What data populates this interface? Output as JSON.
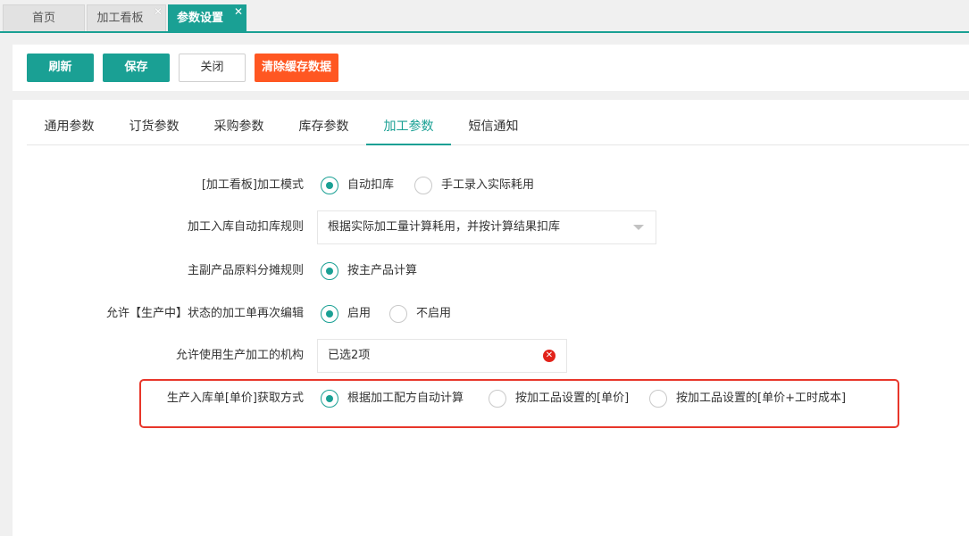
{
  "top_tabs": [
    {
      "label": "首页",
      "closable": false,
      "active": false
    },
    {
      "label": "加工看板",
      "closable": true,
      "active": false
    },
    {
      "label": "参数设置",
      "closable": true,
      "active": true
    }
  ],
  "toolbar": {
    "refresh_label": "刷新",
    "save_label": "保存",
    "close_label": "关闭",
    "clear_cache_label": "清除缓存数据"
  },
  "sub_tabs": [
    "通用参数",
    "订货参数",
    "采购参数",
    "库存参数",
    "加工参数",
    "短信通知"
  ],
  "active_sub_tab": "加工参数",
  "form": {
    "processing_mode": {
      "label": "[加工看板]加工模式",
      "options": [
        "自动扣库",
        "手工录入实际耗用"
      ],
      "selected": "自动扣库"
    },
    "auto_deduct_rule": {
      "label": "加工入库自动扣库规则",
      "value": "根据实际加工量计算耗用，并按计算结果扣库"
    },
    "material_allocation_rule": {
      "label": "主副产品原料分摊规则",
      "options": [
        "按主产品计算"
      ],
      "selected": "按主产品计算"
    },
    "allow_reedit": {
      "label": "允许【生产中】状态的加工单再次编辑",
      "options": [
        "启用",
        "不启用"
      ],
      "selected": "启用"
    },
    "allowed_orgs": {
      "label": "允许使用生产加工的机构",
      "value": "已选2项"
    },
    "unit_price_method": {
      "label": "生产入库单[单价]获取方式",
      "options": [
        "根据加工配方自动计算",
        "按加工品设置的[单价]",
        "按加工品设置的[单价+工时成本]"
      ],
      "selected": "根据加工配方自动计算"
    }
  },
  "colors": {
    "accent": "#1aa094",
    "danger": "#ff5722",
    "highlight": "#e8362a"
  }
}
